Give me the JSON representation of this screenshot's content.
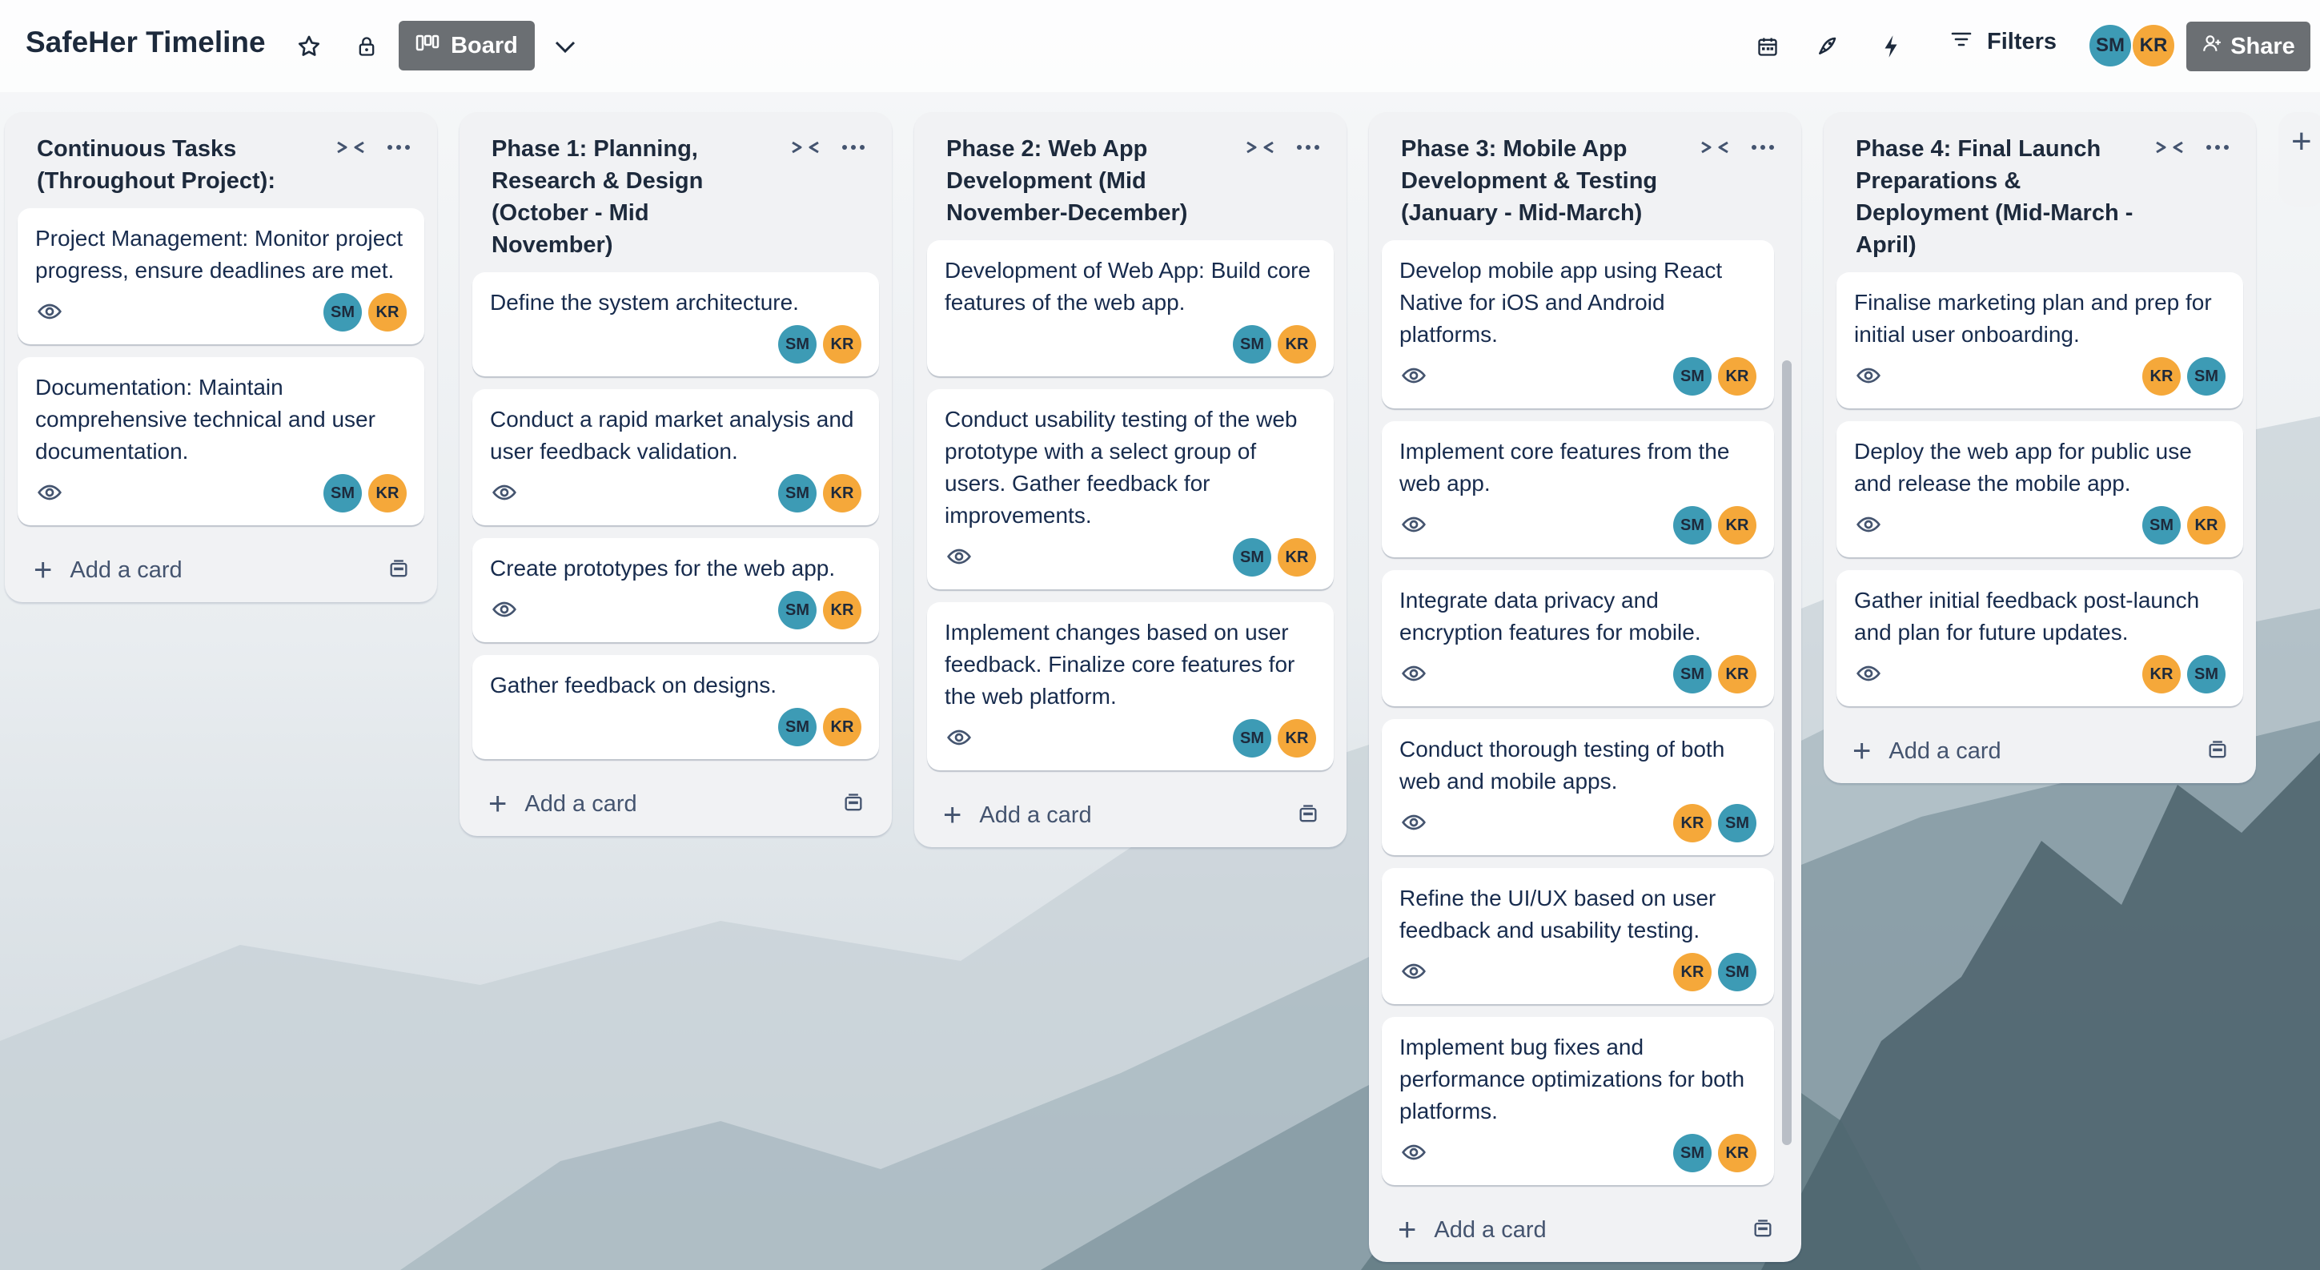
{
  "board": {
    "title": "SafeHer Timeline",
    "view_label": "Board",
    "filters_label": "Filters",
    "share_label": "Share",
    "members": [
      {
        "initials": "SM",
        "color": "#3d9bb5"
      },
      {
        "initials": "KR",
        "color": "#f5a83a"
      }
    ]
  },
  "icons": {
    "star": "star-icon",
    "lock": "lock-icon",
    "board": "board-icon",
    "chevron": "chevron-down-icon",
    "calendar": "calendar-icon",
    "rocket": "rocket-icon",
    "automation": "lightning-icon",
    "filter": "filter-icon",
    "share": "person-add-icon",
    "eye": "eye-icon",
    "collapse": "collapse-icon",
    "menu": "more-icon",
    "template": "card-template-icon",
    "plus": "plus-icon"
  },
  "add_card_label": "Add a card",
  "lists": [
    {
      "title": "Continuous Tasks (Throughout Project):",
      "cards": [
        {
          "text": "Project Management: Monitor project progress, ensure deadlines are met.",
          "members": [
            "SM",
            "KR"
          ]
        },
        {
          "text": "Documentation: Maintain comprehensive technical and user documentation.",
          "members": [
            "SM",
            "KR"
          ]
        }
      ]
    },
    {
      "title": "Phase 1: Planning, Research & Design (October - Mid November)",
      "cards": [
        {
          "text": "Define the system architecture.",
          "members": [
            "SM",
            "KR"
          ],
          "no_eye": true
        },
        {
          "text": "Conduct a rapid market analysis and user feedback validation.",
          "members": [
            "SM",
            "KR"
          ]
        },
        {
          "text": "Create prototypes for the web app.",
          "members": [
            "SM",
            "KR"
          ]
        },
        {
          "text": "Gather feedback on designs.",
          "members": [
            "SM",
            "KR"
          ],
          "no_eye": true
        }
      ]
    },
    {
      "title": "Phase 2: Web App Development (Mid November-December)",
      "cards": [
        {
          "text": "Development of Web App: Build core features of the web app.",
          "members": [
            "SM",
            "KR"
          ],
          "no_eye": true
        },
        {
          "text": "Conduct usability testing of the web prototype with a select group of users. Gather feedback for improvements.",
          "members": [
            "SM",
            "KR"
          ]
        },
        {
          "text": "Implement changes based on user feedback. Finalize core features for the web platform.",
          "members": [
            "SM",
            "KR"
          ]
        }
      ]
    },
    {
      "title": "Phase 3: Mobile App Development & Testing (January - Mid-March)",
      "cards": [
        {
          "text": "Develop mobile app using React Native for iOS and Android platforms.",
          "members": [
            "SM",
            "KR"
          ]
        },
        {
          "text": "Implement core features from the web app.",
          "members": [
            "SM",
            "KR"
          ]
        },
        {
          "text": "Integrate data privacy and encryption features for mobile.",
          "members": [
            "SM",
            "KR"
          ]
        },
        {
          "text": "Conduct thorough testing of both web and mobile apps.",
          "members": [
            "KR",
            "SM"
          ]
        },
        {
          "text": "Refine the UI/UX based on user feedback and usability testing.",
          "members": [
            "KR",
            "SM"
          ]
        },
        {
          "text": "Implement bug fixes and performance optimizations for both platforms.",
          "members": [
            "SM",
            "KR"
          ]
        }
      ]
    },
    {
      "title": "Phase 4: Final Launch Preparations & Deployment (Mid-March - April)",
      "cards": [
        {
          "text": "Finalise marketing plan and prep for initial user onboarding.",
          "members": [
            "KR",
            "SM"
          ]
        },
        {
          "text": "Deploy the web app for public use and release the mobile app.",
          "members": [
            "SM",
            "KR"
          ]
        },
        {
          "text": "Gather initial feedback post-launch and plan for future updates.",
          "members": [
            "KR",
            "SM"
          ]
        }
      ]
    }
  ]
}
